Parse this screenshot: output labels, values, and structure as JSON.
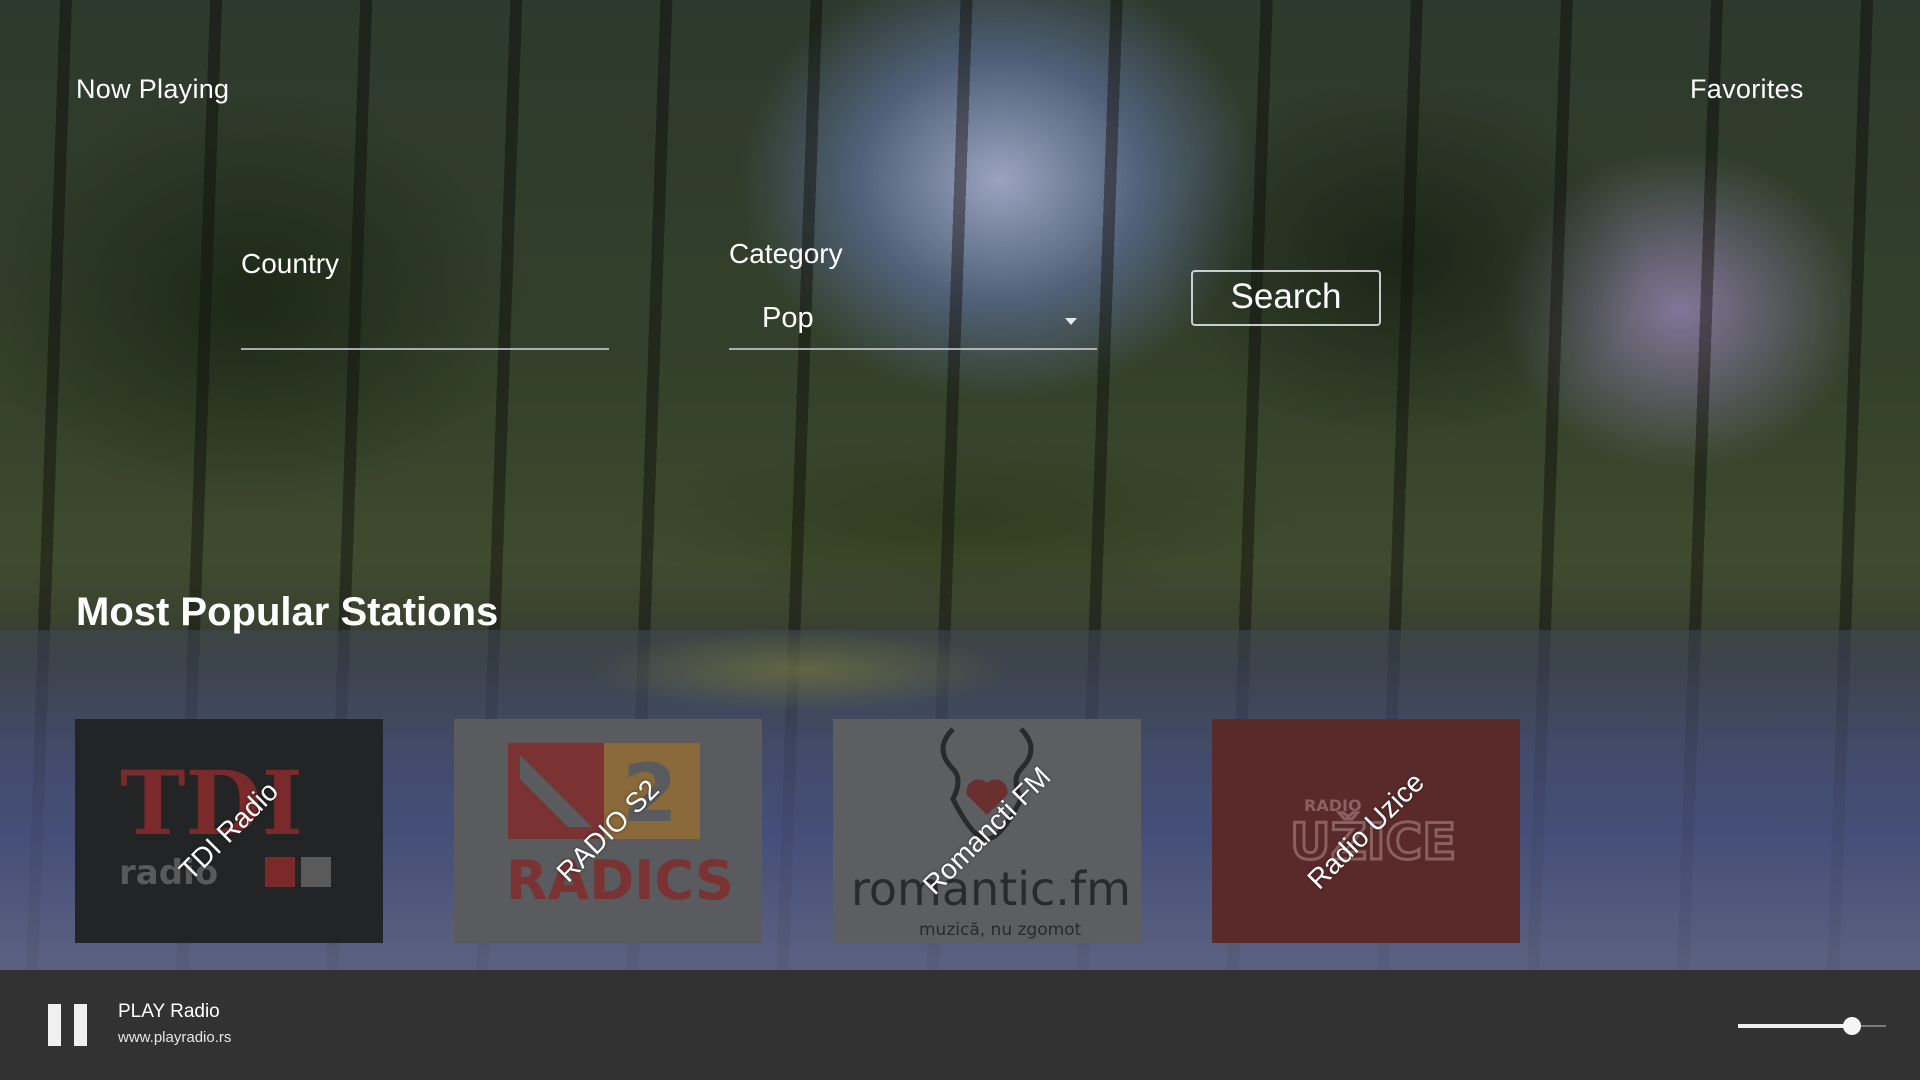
{
  "nav": {
    "now_playing": "Now Playing",
    "favorites": "Favorites"
  },
  "filters": {
    "country_label": "Country",
    "country_value": "",
    "category_label": "Category",
    "category_value": "Pop",
    "search_label": "Search"
  },
  "section_title": "Most Popular Stations",
  "stations": [
    {
      "name": "TDI Radio",
      "logo_text": [
        "TDI",
        "radio"
      ],
      "bg": "#232425"
    },
    {
      "name": "RADIO S2",
      "logo_text": [
        "2",
        "RADICS"
      ],
      "bg": "#5a5b5e"
    },
    {
      "name": "Romancti FM",
      "logo_text": [
        "romantic.fm",
        "muzică, nu zgomot"
      ],
      "bg": "#5d5e60"
    },
    {
      "name": "Radio Uzice",
      "logo_text": [
        "RADIO",
        "UŽICE"
      ],
      "bg": "#5a2a2b"
    }
  ],
  "player": {
    "title": "PLAY Radio",
    "url": "www.playradio.rs",
    "state": "playing",
    "volume": 0.77
  },
  "colors": {
    "player_bar": "#323232",
    "text": "#ffffff"
  },
  "icons": {
    "pause": "pause-icon",
    "dropdown": "chevron-down-icon"
  }
}
